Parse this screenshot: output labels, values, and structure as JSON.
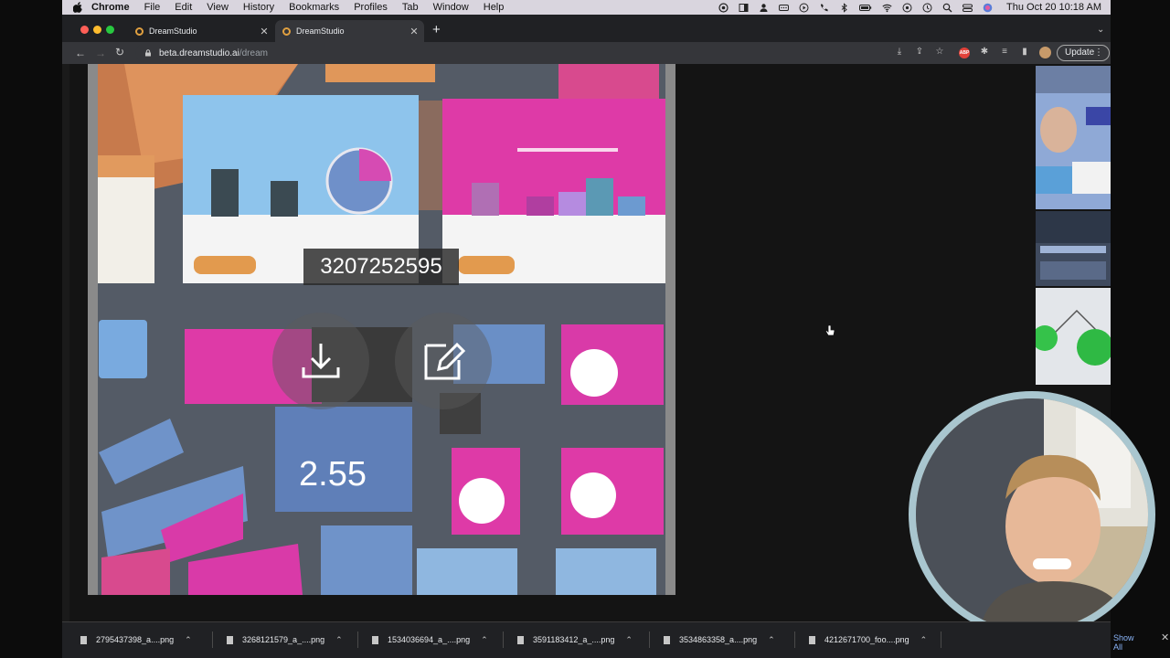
{
  "menubar": {
    "app_name": "Chrome",
    "menus": [
      "File",
      "Edit",
      "View",
      "History",
      "Bookmarks",
      "Profiles",
      "Tab",
      "Window",
      "Help"
    ],
    "clock": "Thu Oct 20  10:18 AM"
  },
  "browser": {
    "tabs": [
      {
        "title": "DreamStudio",
        "active": false
      },
      {
        "title": "DreamStudio",
        "active": true
      }
    ],
    "url_host": "beta.dreamstudio.ai",
    "url_path": "/dream",
    "update_label": "Update"
  },
  "image": {
    "seed": "3207252595",
    "big_number": "2.55"
  },
  "downloads": {
    "items": [
      "2795437398_a....png",
      "3268121579_a_....png",
      "1534036694_a_....png",
      "3591183412_a_....png",
      "3534863358_a....png",
      "4212671700_foo....png"
    ],
    "show_all": "Show All"
  },
  "colors": {
    "chrome_dark": "#202124",
    "toolbar": "#35363a",
    "magenta": "#d93aa8",
    "blue": "#6f93c9",
    "orange": "#e0975a"
  }
}
